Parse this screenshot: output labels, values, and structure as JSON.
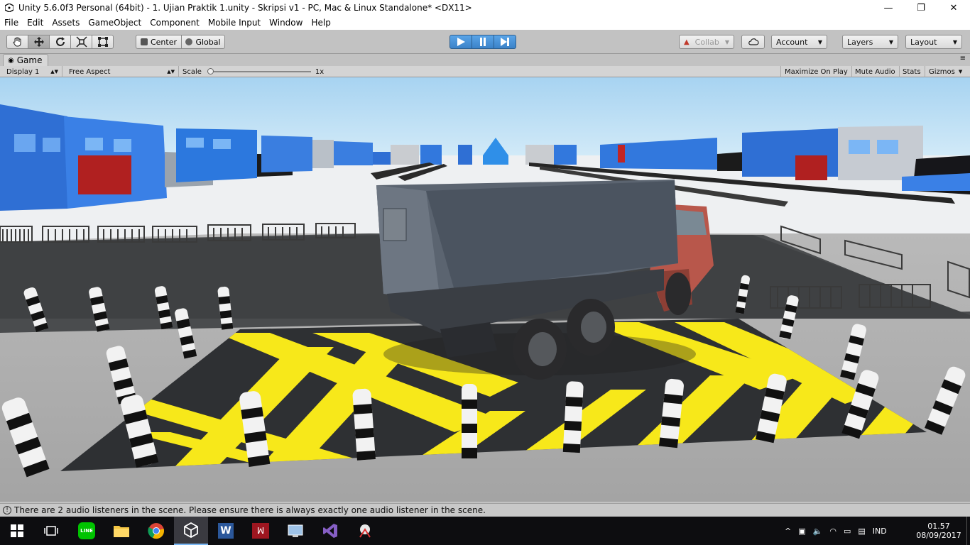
{
  "window": {
    "title": "Unity 5.6.0f3 Personal (64bit) - 1. Ujian Praktik 1.unity - Skripsi v1 - PC, Mac & Linux Standalone* <DX11>",
    "minimize": "—",
    "maximize": "❐",
    "close": "✕"
  },
  "menu": [
    "File",
    "Edit",
    "Assets",
    "GameObject",
    "Component",
    "Mobile Input",
    "Window",
    "Help"
  ],
  "toolbar": {
    "tools": [
      "hand-icon",
      "move-icon",
      "rotate-icon",
      "scale-icon",
      "rect-tool-icon"
    ],
    "pivot_label": "Center",
    "space_label": "Global",
    "collab_label": "Collab",
    "account_label": "Account",
    "layers_label": "Layers",
    "layout_label": "Layout"
  },
  "game_tab": {
    "label": "Game",
    "display": "Display 1",
    "aspect": "Free Aspect",
    "scale_label": "Scale",
    "scale_value": "1x",
    "maximize_on_play": "Maximize On Play",
    "mute_audio": "Mute Audio",
    "stats": "Stats",
    "gizmos": "Gizmos"
  },
  "status": {
    "message": "There are 2 audio listeners in the scene. Please ensure there is always exactly one audio listener in the scene."
  },
  "taskbar": {
    "apps": [
      "windows-start-icon",
      "task-view-icon",
      "line-app-icon",
      "file-explorer-icon",
      "chrome-icon",
      "unity-icon",
      "word-icon",
      "mendeley-icon",
      "control-panel-icon",
      "visual-studio-icon",
      "snipping-tool-icon"
    ],
    "language": "IND",
    "time": "01.57",
    "date": "08/09/2017"
  },
  "colors": {
    "play_active": "#3b82c8",
    "editor_gray": "#c2c2c2",
    "hazard_yellow": "#f7e81a",
    "sky": "#bfe2f7"
  }
}
